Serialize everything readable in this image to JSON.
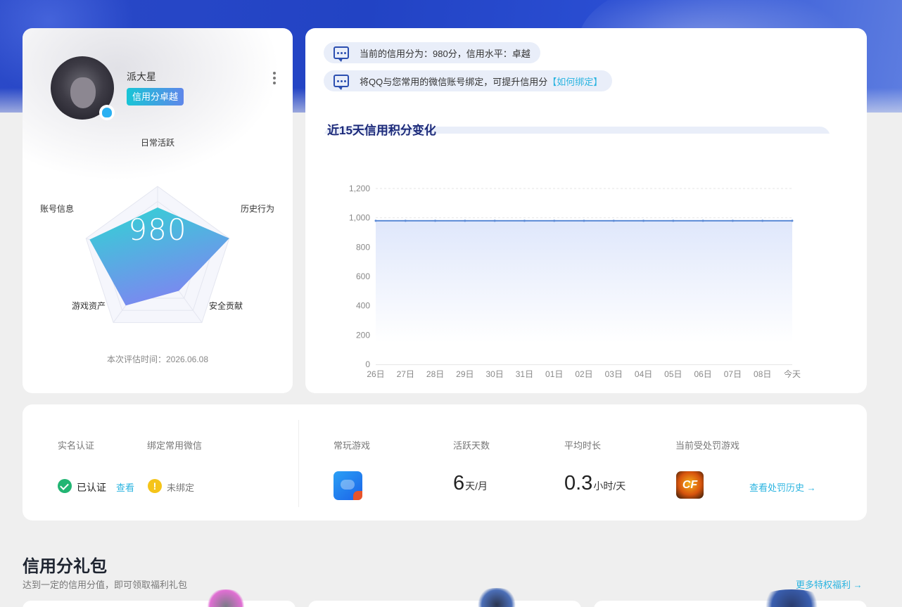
{
  "profile": {
    "nickname": "派大星",
    "level_badge": "信用分卓越",
    "score": "980",
    "eval_time": "本次评估时间：2026.06.08",
    "radar": {
      "labels": [
        "日常活跃",
        "历史行为",
        "安全贡献",
        "游戏资产",
        "账号信息"
      ],
      "values": [
        0.72,
        1.0,
        0.48,
        0.72,
        0.95
      ]
    }
  },
  "tips": [
    {
      "text": "当前的信用分为：980分，信用水平：卓越",
      "link": ""
    },
    {
      "text": "将QQ与您常用的微信账号绑定，可提升信用分",
      "link": "【如何绑定】"
    }
  ],
  "trend": {
    "title": "近15天信用积分变化"
  },
  "chart_data": {
    "type": "area",
    "title": "近15天信用积分变化",
    "xlabel": "",
    "ylabel": "",
    "categories": [
      "26日",
      "27日",
      "28日",
      "29日",
      "30日",
      "31日",
      "01日",
      "02日",
      "03日",
      "04日",
      "05日",
      "06日",
      "07日",
      "08日",
      "今天"
    ],
    "values": [
      980,
      980,
      980,
      980,
      980,
      980,
      980,
      980,
      980,
      980,
      980,
      980,
      980,
      980,
      980
    ],
    "ylim": [
      0,
      1200
    ],
    "yticks": [
      "0",
      "200",
      "400",
      "600",
      "800",
      "1,000",
      "1,200"
    ],
    "grid": true,
    "line_color": "#5b8ad6"
  },
  "stats": {
    "realname_label": "实名认证",
    "realname_value": "已认证",
    "realname_link": "查看",
    "wechat_label": "绑定常用微信",
    "wechat_value": "未绑定",
    "frequent_game_label": "常玩游戏",
    "active_days_label": "活跃天数",
    "active_days_value": "6",
    "active_days_unit": "天/月",
    "avg_duration_label": "平均时长",
    "avg_duration_value": "0.3",
    "avg_duration_unit": "小时/天",
    "penalty_game_label": "当前受处罚游戏",
    "penalty_game_icon_text": "CF",
    "penalty_link": "查看处罚历史 →",
    "warn_symbol": "!"
  },
  "gifts": {
    "title": "信用分礼包",
    "subtitle": "达到一定的信用分值，即可领取福利礼包",
    "more_link": "更多特权福利 →"
  },
  "colors": {
    "accent": "#2bb4e0",
    "title_navy": "#1c2a7a",
    "hero_blue": "#2243c4"
  }
}
